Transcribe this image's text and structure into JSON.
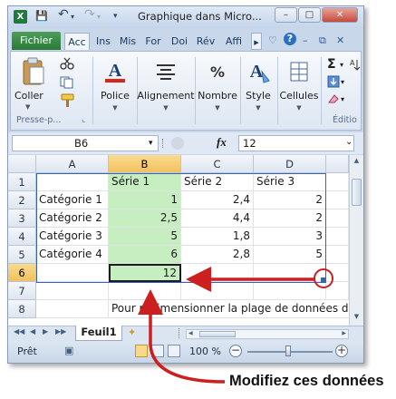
{
  "window": {
    "title": "Graphique dans Micro...",
    "app_icon": "X",
    "controls": {
      "minimize": "–",
      "maximize": "□",
      "close": "✕"
    }
  },
  "qat": {
    "save_icon": "💾",
    "undo_icon": "↶",
    "undo_drop": "▾",
    "redo_icon": "↷",
    "redo_drop": "▾",
    "customize": "▾"
  },
  "ribbon_tabs": {
    "file": "Fichier",
    "tabs": [
      "Acc",
      "Ins",
      "Mis",
      "For",
      "Doi",
      "Rév",
      "Affi"
    ],
    "more": "▸",
    "help_icon": "?",
    "extra": [
      "♡",
      "–",
      "⧉",
      "✕"
    ]
  },
  "ribbon": {
    "clipboard": {
      "paste_label": "Coller",
      "group_label": "Presse-p...",
      "launcher": "⌞"
    },
    "font": {
      "label": "Police",
      "glyph": "A"
    },
    "alignment": {
      "label": "Alignement",
      "glyph": "≡"
    },
    "number": {
      "label": "Nombre",
      "glyph": "%"
    },
    "style": {
      "label": "Style",
      "glyph": "A"
    },
    "cells": {
      "label": "Cellules",
      "glyph": "▦"
    },
    "editing": {
      "sigma": "Σ",
      "sigma_drop": "▾",
      "fill_drop": "▾",
      "clear_drop": "▾",
      "sort": "A",
      "group_label": "Éditio"
    }
  },
  "formula_bar": {
    "name_box": "B6",
    "name_drop": "▾",
    "fx": "fx",
    "value": "12",
    "expand": "⌄"
  },
  "sheet": {
    "columns": [
      "A",
      "B",
      "C",
      "D"
    ],
    "selected_column": "B",
    "selected_row": "6",
    "rows": [
      {
        "n": "1",
        "cells": [
          "",
          "Série 1",
          "Série 2",
          "Série 3"
        ]
      },
      {
        "n": "2",
        "cells": [
          "Catégorie 1",
          "1",
          "2,4",
          "2"
        ]
      },
      {
        "n": "3",
        "cells": [
          "Catégorie 2",
          "2,5",
          "4,4",
          "2"
        ]
      },
      {
        "n": "4",
        "cells": [
          "Catégorie 3",
          "5",
          "1,8",
          "3"
        ]
      },
      {
        "n": "5",
        "cells": [
          "Catégorie 4",
          "6",
          "2,8",
          "5"
        ]
      },
      {
        "n": "6",
        "cells": [
          "",
          "12",
          "",
          ""
        ]
      },
      {
        "n": "7",
        "cells": [
          "",
          "",
          "",
          ""
        ]
      },
      {
        "n": "8",
        "cells": [
          "",
          "Pour redimensionner la plage de données de",
          "",
          ""
        ]
      }
    ]
  },
  "sheet_tabs": {
    "nav": [
      "◀◀",
      "◀",
      "▶",
      "▶▶"
    ],
    "active": "Feuil1",
    "insert_icon": "✦"
  },
  "status_bar": {
    "ready": "Prêt",
    "macro_icon": "▣",
    "zoom": "100 %",
    "zoom_out": "−",
    "zoom_in": "+"
  },
  "callout": {
    "text": "Modifiez ces données",
    "arrow_color": "#cc1f1f"
  }
}
